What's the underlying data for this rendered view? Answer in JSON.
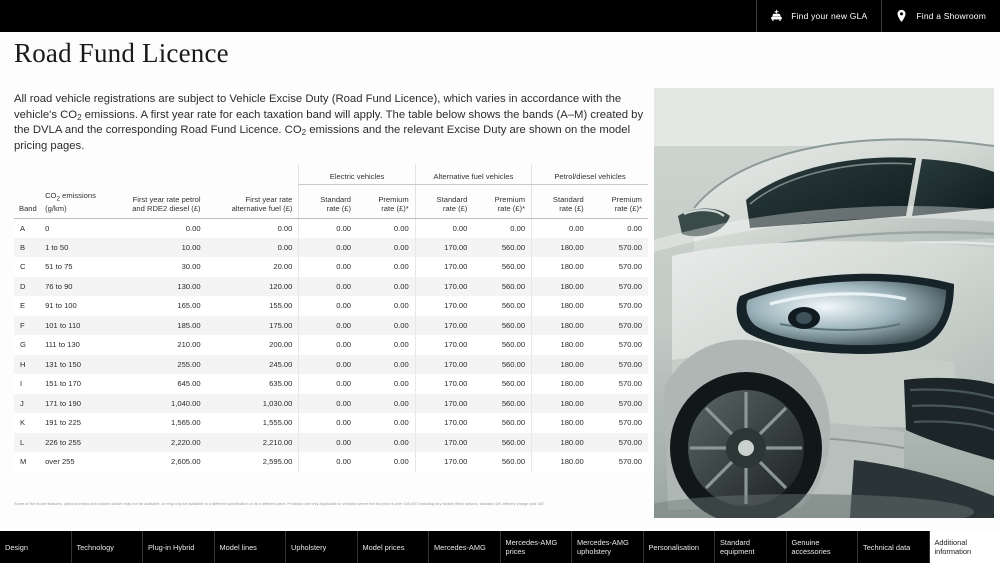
{
  "topbar": {
    "buttons": [
      {
        "id": "find-gla",
        "label": "Find your new GLA",
        "icon": "car-icon"
      },
      {
        "id": "find-showroom",
        "label": "Find a Showroom",
        "icon": "map-pin-icon"
      }
    ]
  },
  "page": {
    "title": "Road Fund Licence",
    "intro_part1": "All road vehicle registrations are subject to Vehicle Excise Duty (Road Fund Licence), which varies in accordance with the vehicle's CO",
    "intro_sub1": "2",
    "intro_part2": " emissions. A first year rate for each taxation band will apply. The table below shows the bands (A–M) created by the DVLA and the corresponding Road Fund Licence. CO",
    "intro_sub2": "2",
    "intro_part3": " emissions and the relevant Excise Duty are shown on the model pricing pages.",
    "footnote": "Some of the model features, optional extras and colours shown may not be available, or may only be available in a different specification or at a different price. Provision are only applicable to vehicles where the list price is over £40,000 including any factory fitted options, standard UK delivery charge and VAT."
  },
  "table": {
    "group_headers": [
      {
        "label": "",
        "span": 4
      },
      {
        "label": "Electric vehicles",
        "span": 2
      },
      {
        "label": "Alternative fuel vehicles",
        "span": 2
      },
      {
        "label": "Petrol/diesel vehicles",
        "span": 2
      }
    ],
    "columns": [
      "Band",
      "CO2 emissions (g/km)",
      "First year rate petrol and RDE2 diesel (£)",
      "First year rate alternative fuel (£)",
      "Standard rate (£)",
      "Premium rate (£)*",
      "Standard rate (£)",
      "Premium rate (£)*",
      "Standard rate (£)",
      "Premium rate (£)*"
    ],
    "headers": {
      "band": "Band",
      "emissions_l1": "CO",
      "emissions_sub": "2",
      "emissions_l1b": " emissions",
      "emissions_l2": "(g/km)",
      "fy_petrol_l1": "First year rate petrol",
      "fy_petrol_l2": "and RDE2 diesel (£)",
      "fy_alt_l1": "First year rate",
      "fy_alt_l2": "alternative fuel (£)",
      "standard_l1": "Standard",
      "standard_l2": "rate (£)",
      "premium_l1": "Premium",
      "premium_l2": "rate (£)*",
      "grp_electric": "Electric vehicles",
      "grp_altfuel": "Alternative fuel vehicles",
      "grp_petroldiesel": "Petrol/diesel vehicles"
    },
    "rows": [
      {
        "band": "A",
        "emissions": "0",
        "fy_petrol": "0.00",
        "fy_alt": "0.00",
        "ev_std": "0.00",
        "ev_prem": "0.00",
        "af_std": "0.00",
        "af_prem": "0.00",
        "pd_std": "0.00",
        "pd_prem": "0.00"
      },
      {
        "band": "B",
        "emissions": "1 to 50",
        "fy_petrol": "10.00",
        "fy_alt": "0.00",
        "ev_std": "0.00",
        "ev_prem": "0.00",
        "af_std": "170.00",
        "af_prem": "560.00",
        "pd_std": "180.00",
        "pd_prem": "570.00"
      },
      {
        "band": "C",
        "emissions": "51 to 75",
        "fy_petrol": "30.00",
        "fy_alt": "20.00",
        "ev_std": "0.00",
        "ev_prem": "0.00",
        "af_std": "170.00",
        "af_prem": "560.00",
        "pd_std": "180.00",
        "pd_prem": "570.00"
      },
      {
        "band": "D",
        "emissions": "76 to 90",
        "fy_petrol": "130.00",
        "fy_alt": "120.00",
        "ev_std": "0.00",
        "ev_prem": "0.00",
        "af_std": "170.00",
        "af_prem": "560.00",
        "pd_std": "180.00",
        "pd_prem": "570.00"
      },
      {
        "band": "E",
        "emissions": "91 to 100",
        "fy_petrol": "165.00",
        "fy_alt": "155.00",
        "ev_std": "0.00",
        "ev_prem": "0.00",
        "af_std": "170.00",
        "af_prem": "560.00",
        "pd_std": "180.00",
        "pd_prem": "570.00"
      },
      {
        "band": "F",
        "emissions": "101 to 110",
        "fy_petrol": "185.00",
        "fy_alt": "175.00",
        "ev_std": "0.00",
        "ev_prem": "0.00",
        "af_std": "170.00",
        "af_prem": "560.00",
        "pd_std": "180.00",
        "pd_prem": "570.00"
      },
      {
        "band": "G",
        "emissions": "111 to 130",
        "fy_petrol": "210.00",
        "fy_alt": "200.00",
        "ev_std": "0.00",
        "ev_prem": "0.00",
        "af_std": "170.00",
        "af_prem": "560.00",
        "pd_std": "180.00",
        "pd_prem": "570.00"
      },
      {
        "band": "H",
        "emissions": "131 to 150",
        "fy_petrol": "255.00",
        "fy_alt": "245.00",
        "ev_std": "0.00",
        "ev_prem": "0.00",
        "af_std": "170.00",
        "af_prem": "560.00",
        "pd_std": "180.00",
        "pd_prem": "570.00"
      },
      {
        "band": "I",
        "emissions": "151 to 170",
        "fy_petrol": "645.00",
        "fy_alt": "635.00",
        "ev_std": "0.00",
        "ev_prem": "0.00",
        "af_std": "170.00",
        "af_prem": "560.00",
        "pd_std": "180.00",
        "pd_prem": "570.00"
      },
      {
        "band": "J",
        "emissions": "171 to 190",
        "fy_petrol": "1,040.00",
        "fy_alt": "1,030.00",
        "ev_std": "0.00",
        "ev_prem": "0.00",
        "af_std": "170.00",
        "af_prem": "560.00",
        "pd_std": "180.00",
        "pd_prem": "570.00"
      },
      {
        "band": "K",
        "emissions": "191 to 225",
        "fy_petrol": "1,565.00",
        "fy_alt": "1,555.00",
        "ev_std": "0.00",
        "ev_prem": "0.00",
        "af_std": "170.00",
        "af_prem": "560.00",
        "pd_std": "180.00",
        "pd_prem": "570.00"
      },
      {
        "band": "L",
        "emissions": "226 to 255",
        "fy_petrol": "2,220.00",
        "fy_alt": "2,210.00",
        "ev_std": "0.00",
        "ev_prem": "0.00",
        "af_std": "170.00",
        "af_prem": "560.00",
        "pd_std": "180.00",
        "pd_prem": "570.00"
      },
      {
        "band": "M",
        "emissions": "over 255",
        "fy_petrol": "2,605.00",
        "fy_alt": "2,595.00",
        "ev_std": "0.00",
        "ev_prem": "0.00",
        "af_std": "170.00",
        "af_prem": "560.00",
        "pd_std": "180.00",
        "pd_prem": "570.00"
      }
    ]
  },
  "bottom_nav": {
    "tabs": [
      {
        "label": "Design",
        "active": false
      },
      {
        "label": "Technology",
        "active": false
      },
      {
        "label": "Plug-in Hybrid",
        "active": false
      },
      {
        "label": "Model lines",
        "active": false
      },
      {
        "label": "Upholstery",
        "active": false
      },
      {
        "label": "Model prices",
        "active": false
      },
      {
        "label": "Mercedes-AMG",
        "active": false
      },
      {
        "label": "Mercedes-AMG prices",
        "active": false
      },
      {
        "label": "Mercedes-AMG upholstery",
        "active": false
      },
      {
        "label": "Personalisation",
        "active": false
      },
      {
        "label": "Standard equipment",
        "active": false
      },
      {
        "label": "Genuine accessories",
        "active": false
      },
      {
        "label": "Technical data",
        "active": false
      },
      {
        "label": "Additional information",
        "active": true
      }
    ]
  },
  "hero": {
    "alt": "mercedes-front-quarter-photo",
    "body_color": "#d8dcd8"
  }
}
